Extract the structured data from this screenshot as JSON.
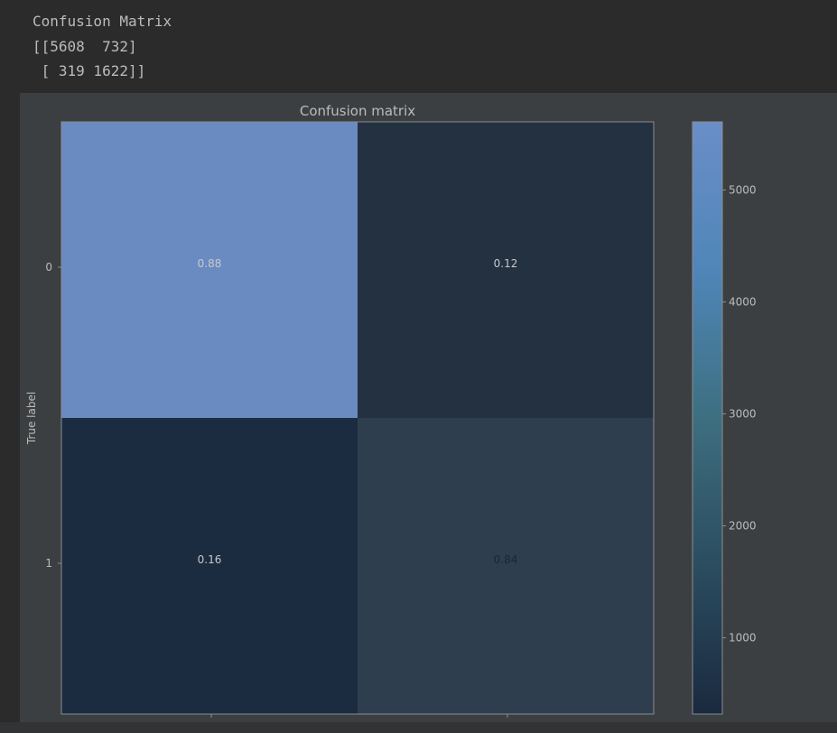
{
  "console": {
    "lines": [
      "Confusion Matrix",
      "[[5608  732]",
      " [ 319 1622]]"
    ]
  },
  "colors": {
    "page_bg": "#2b2b2b",
    "plot_bg": "#3c3f41",
    "text": "#bbbbbb",
    "colorbar_low": "#1a2a3f",
    "colorbar_mid": "#3d6f80",
    "colorbar_high": "#6a8ec8"
  },
  "chart_data": {
    "type": "heatmap",
    "title": "Confusion matrix",
    "ylabel": "True label",
    "xlabel": "",
    "row_labels": [
      "0",
      "1"
    ],
    "col_labels": [
      "",
      ""
    ],
    "counts": [
      [
        5608,
        732
      ],
      [
        319,
        1622
      ]
    ],
    "cell_labels": [
      [
        "0.88",
        "0.12"
      ],
      [
        "0.16",
        "0.84"
      ]
    ],
    "cell_colors": [
      [
        "#6a8bc2",
        "#233140"
      ],
      [
        "#1b2b40",
        "#2e3e4f"
      ]
    ],
    "colorbar": {
      "ticks": [
        5000,
        4000,
        3000,
        2000,
        1000
      ],
      "range": [
        319,
        5608
      ]
    }
  }
}
